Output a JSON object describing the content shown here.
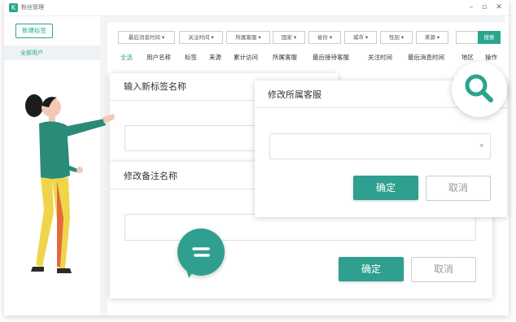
{
  "window": {
    "title": "粉丝管理",
    "logo_letter": "K",
    "minimize": "–",
    "restore": "▫",
    "close": "✕"
  },
  "sidebar": {
    "new_tag_button": "新建标签",
    "items": [
      {
        "label": "全部用户"
      }
    ]
  },
  "filters": [
    {
      "label": "最后消息时间 ▾"
    },
    {
      "label": "关注时间 ▾"
    },
    {
      "label": "所属客服 ▾"
    },
    {
      "label": "国家 ▾"
    },
    {
      "label": "省份 ▾"
    },
    {
      "label": "城市 ▾"
    },
    {
      "label": "性别 ▾"
    },
    {
      "label": "来源 ▾"
    }
  ],
  "search": {
    "button": "搜索",
    "placeholder": ""
  },
  "columns": [
    {
      "label": "全选"
    },
    {
      "label": "用户名称"
    },
    {
      "label": "标签"
    },
    {
      "label": "来源"
    },
    {
      "label": "累计访问"
    },
    {
      "label": "所属客服"
    },
    {
      "label": "最后接待客服"
    },
    {
      "label": "关注时间"
    },
    {
      "label": "最后消息时间"
    },
    {
      "label": "地区"
    },
    {
      "label": "操作"
    }
  ],
  "dialog_tag": {
    "title": "输入新标签名称"
  },
  "dialog_remark": {
    "title": "修改备注名称",
    "confirm": "确定",
    "cancel": "取消"
  },
  "dialog_service": {
    "title": "修改所属客服",
    "select_arrow": "▾",
    "confirm": "确定",
    "cancel": "取消"
  },
  "colors": {
    "accent": "#2aa58e",
    "button": "#2f9f8f"
  }
}
